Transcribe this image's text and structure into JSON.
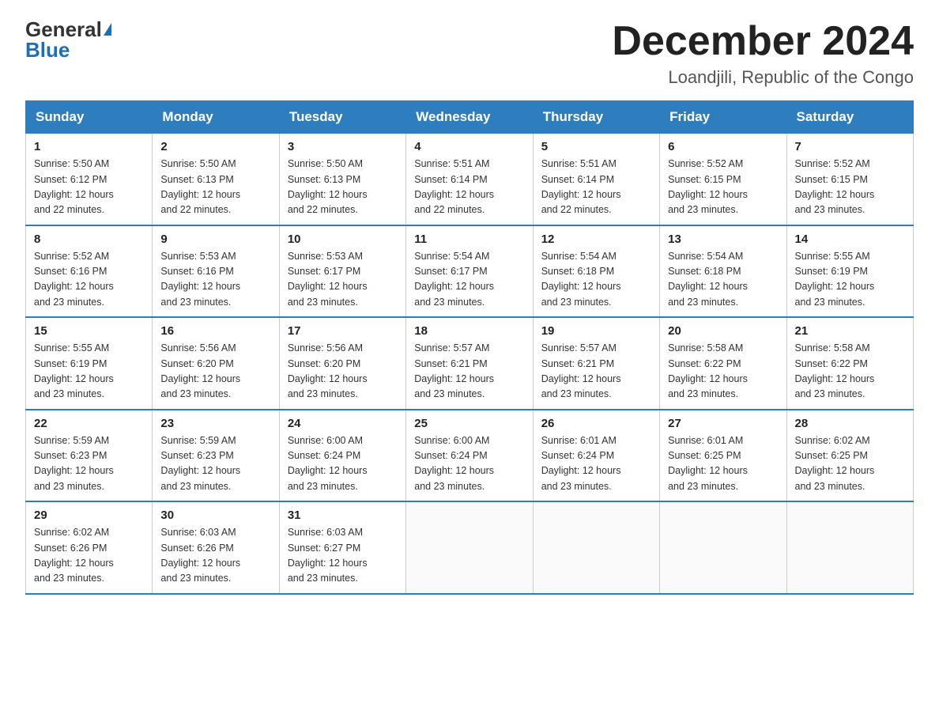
{
  "header": {
    "logo_general": "General",
    "logo_blue": "Blue",
    "month_title": "December 2024",
    "location": "Loandjili, Republic of the Congo"
  },
  "days_of_week": [
    "Sunday",
    "Monday",
    "Tuesday",
    "Wednesday",
    "Thursday",
    "Friday",
    "Saturday"
  ],
  "weeks": [
    [
      {
        "day": "1",
        "sunrise": "5:50 AM",
        "sunset": "6:12 PM",
        "daylight": "12 hours and 22 minutes."
      },
      {
        "day": "2",
        "sunrise": "5:50 AM",
        "sunset": "6:13 PM",
        "daylight": "12 hours and 22 minutes."
      },
      {
        "day": "3",
        "sunrise": "5:50 AM",
        "sunset": "6:13 PM",
        "daylight": "12 hours and 22 minutes."
      },
      {
        "day": "4",
        "sunrise": "5:51 AM",
        "sunset": "6:14 PM",
        "daylight": "12 hours and 22 minutes."
      },
      {
        "day": "5",
        "sunrise": "5:51 AM",
        "sunset": "6:14 PM",
        "daylight": "12 hours and 22 minutes."
      },
      {
        "day": "6",
        "sunrise": "5:52 AM",
        "sunset": "6:15 PM",
        "daylight": "12 hours and 23 minutes."
      },
      {
        "day": "7",
        "sunrise": "5:52 AM",
        "sunset": "6:15 PM",
        "daylight": "12 hours and 23 minutes."
      }
    ],
    [
      {
        "day": "8",
        "sunrise": "5:52 AM",
        "sunset": "6:16 PM",
        "daylight": "12 hours and 23 minutes."
      },
      {
        "day": "9",
        "sunrise": "5:53 AM",
        "sunset": "6:16 PM",
        "daylight": "12 hours and 23 minutes."
      },
      {
        "day": "10",
        "sunrise": "5:53 AM",
        "sunset": "6:17 PM",
        "daylight": "12 hours and 23 minutes."
      },
      {
        "day": "11",
        "sunrise": "5:54 AM",
        "sunset": "6:17 PM",
        "daylight": "12 hours and 23 minutes."
      },
      {
        "day": "12",
        "sunrise": "5:54 AM",
        "sunset": "6:18 PM",
        "daylight": "12 hours and 23 minutes."
      },
      {
        "day": "13",
        "sunrise": "5:54 AM",
        "sunset": "6:18 PM",
        "daylight": "12 hours and 23 minutes."
      },
      {
        "day": "14",
        "sunrise": "5:55 AM",
        "sunset": "6:19 PM",
        "daylight": "12 hours and 23 minutes."
      }
    ],
    [
      {
        "day": "15",
        "sunrise": "5:55 AM",
        "sunset": "6:19 PM",
        "daylight": "12 hours and 23 minutes."
      },
      {
        "day": "16",
        "sunrise": "5:56 AM",
        "sunset": "6:20 PM",
        "daylight": "12 hours and 23 minutes."
      },
      {
        "day": "17",
        "sunrise": "5:56 AM",
        "sunset": "6:20 PM",
        "daylight": "12 hours and 23 minutes."
      },
      {
        "day": "18",
        "sunrise": "5:57 AM",
        "sunset": "6:21 PM",
        "daylight": "12 hours and 23 minutes."
      },
      {
        "day": "19",
        "sunrise": "5:57 AM",
        "sunset": "6:21 PM",
        "daylight": "12 hours and 23 minutes."
      },
      {
        "day": "20",
        "sunrise": "5:58 AM",
        "sunset": "6:22 PM",
        "daylight": "12 hours and 23 minutes."
      },
      {
        "day": "21",
        "sunrise": "5:58 AM",
        "sunset": "6:22 PM",
        "daylight": "12 hours and 23 minutes."
      }
    ],
    [
      {
        "day": "22",
        "sunrise": "5:59 AM",
        "sunset": "6:23 PM",
        "daylight": "12 hours and 23 minutes."
      },
      {
        "day": "23",
        "sunrise": "5:59 AM",
        "sunset": "6:23 PM",
        "daylight": "12 hours and 23 minutes."
      },
      {
        "day": "24",
        "sunrise": "6:00 AM",
        "sunset": "6:24 PM",
        "daylight": "12 hours and 23 minutes."
      },
      {
        "day": "25",
        "sunrise": "6:00 AM",
        "sunset": "6:24 PM",
        "daylight": "12 hours and 23 minutes."
      },
      {
        "day": "26",
        "sunrise": "6:01 AM",
        "sunset": "6:24 PM",
        "daylight": "12 hours and 23 minutes."
      },
      {
        "day": "27",
        "sunrise": "6:01 AM",
        "sunset": "6:25 PM",
        "daylight": "12 hours and 23 minutes."
      },
      {
        "day": "28",
        "sunrise": "6:02 AM",
        "sunset": "6:25 PM",
        "daylight": "12 hours and 23 minutes."
      }
    ],
    [
      {
        "day": "29",
        "sunrise": "6:02 AM",
        "sunset": "6:26 PM",
        "daylight": "12 hours and 23 minutes."
      },
      {
        "day": "30",
        "sunrise": "6:03 AM",
        "sunset": "6:26 PM",
        "daylight": "12 hours and 23 minutes."
      },
      {
        "day": "31",
        "sunrise": "6:03 AM",
        "sunset": "6:27 PM",
        "daylight": "12 hours and 23 minutes."
      },
      null,
      null,
      null,
      null
    ]
  ],
  "labels": {
    "sunrise": "Sunrise:",
    "sunset": "Sunset:",
    "daylight": "Daylight:"
  }
}
